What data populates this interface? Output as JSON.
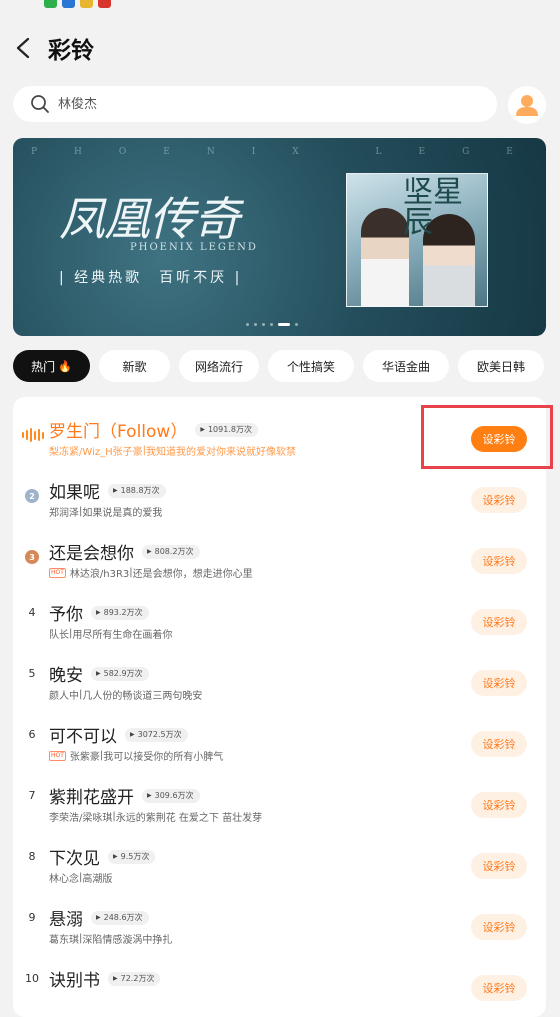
{
  "header": {
    "title": "彩铃"
  },
  "search": {
    "placeholder": "林俊杰"
  },
  "banner": {
    "latin_text": "PHOENIX LEGEND",
    "title": "凤凰传奇",
    "subtitle": "PHOENIX LEGEND",
    "slogan": "| 经典热歌　百听不厌 |",
    "album_title": "坚星辰",
    "slide_count": 6,
    "active_slide": 5
  },
  "tabs": [
    {
      "label": "热门",
      "active": true,
      "icon": "flame-icon"
    },
    {
      "label": "新歌"
    },
    {
      "label": "网络流行"
    },
    {
      "label": "个性搞笑"
    },
    {
      "label": "华语金曲"
    },
    {
      "label": "欧美日韩"
    }
  ],
  "songs": [
    {
      "rank": "",
      "rank_icon": "playing-wave-icon",
      "title": "罗生门（Follow）",
      "plays": "1091.8万次",
      "artist": "梨冻紧/Wiz_H张子豪",
      "lyric": "我知道我的爱对你来说就好像软禁",
      "hot": false,
      "playing": true,
      "button": "设彩铃"
    },
    {
      "rank": "2",
      "rank_icon": "silver-medal-icon",
      "title": "如果呢",
      "plays": "188.8万次",
      "artist": "郑润泽",
      "lyric": "如果说是真的爱我",
      "hot": false,
      "button": "设彩铃"
    },
    {
      "rank": "3",
      "rank_icon": "bronze-medal-icon",
      "title": "还是会想你",
      "plays": "808.2万次",
      "artist": "林达浪/h3R3",
      "lyric": "还是会想你，想走进你心里",
      "hot": true,
      "button": "设彩铃"
    },
    {
      "rank": "4",
      "title": "予你",
      "plays": "893.2万次",
      "artist": "队长",
      "lyric": "用尽所有生命在画着你",
      "hot": false,
      "button": "设彩铃"
    },
    {
      "rank": "5",
      "title": "晚安",
      "plays": "582.9万次",
      "artist": "颜人中",
      "lyric": "几人份的畅谈道三两句晚安",
      "hot": false,
      "button": "设彩铃"
    },
    {
      "rank": "6",
      "title": "可不可以",
      "plays": "3072.5万次",
      "artist": "张紫豪",
      "lyric": "我可以接受你的所有小脾气",
      "hot": true,
      "button": "设彩铃"
    },
    {
      "rank": "7",
      "title": "紫荆花盛开",
      "plays": "309.6万次",
      "artist": "李荣浩/梁咏琪",
      "lyric": "永远的紫荆花 在爱之下 苗壮发芽",
      "hot": false,
      "button": "设彩铃"
    },
    {
      "rank": "8",
      "title": "下次见",
      "plays": "9.5万次",
      "artist": "林心念",
      "lyric": "高潮版",
      "hot": false,
      "button": "设彩铃"
    },
    {
      "rank": "9",
      "title": "悬溺",
      "plays": "248.6万次",
      "artist": "葛东琪",
      "lyric": "深陷情感漩涡中挣扎",
      "hot": false,
      "button": "设彩铃"
    },
    {
      "rank": "10",
      "title": "诀别书",
      "plays": "72.2万次",
      "artist": "",
      "lyric": "",
      "hot": false,
      "button": "设彩铃"
    }
  ],
  "colors": {
    "accent": "#ff7a1a",
    "highlight": "#e8424a",
    "background": "#f2f2f2"
  }
}
